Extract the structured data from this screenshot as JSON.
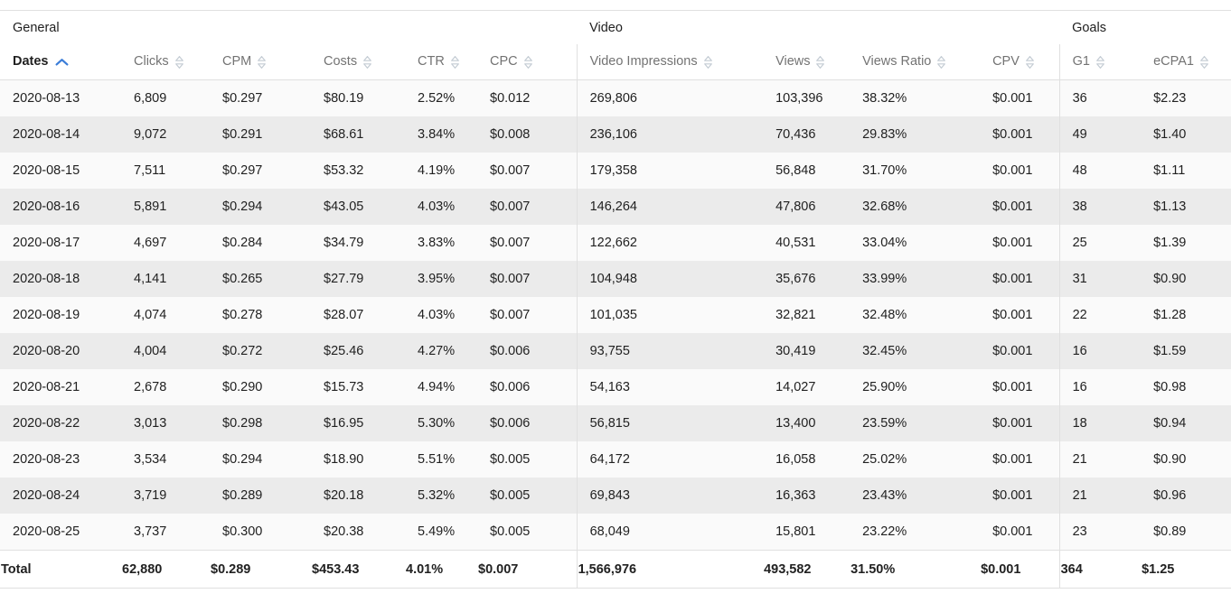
{
  "groups": [
    {
      "id": "general",
      "label": "General",
      "span": 6
    },
    {
      "id": "video",
      "label": "Video",
      "span": 4
    },
    {
      "id": "goals",
      "label": "Goals",
      "span": 2
    }
  ],
  "sort": {
    "active_column": "Dates",
    "direction": "asc",
    "active_color": "#3b7dd8",
    "inactive_color": "#c4ccd4"
  },
  "columns": [
    {
      "key": "dates",
      "label": "Dates",
      "sortable": true,
      "active": true
    },
    {
      "key": "clicks",
      "label": "Clicks",
      "sortable": true,
      "active": false
    },
    {
      "key": "cpm",
      "label": "CPM",
      "sortable": true,
      "active": false
    },
    {
      "key": "costs",
      "label": "Costs",
      "sortable": true,
      "active": false
    },
    {
      "key": "ctr",
      "label": "CTR",
      "sortable": true,
      "active": false
    },
    {
      "key": "cpc",
      "label": "CPC",
      "sortable": true,
      "active": false
    },
    {
      "key": "vimp",
      "label": "Video Impressions",
      "sortable": true,
      "active": false
    },
    {
      "key": "views",
      "label": "Views",
      "sortable": true,
      "active": false
    },
    {
      "key": "vratio",
      "label": "Views Ratio",
      "sortable": true,
      "active": false
    },
    {
      "key": "cpv",
      "label": "CPV",
      "sortable": true,
      "active": false
    },
    {
      "key": "g1",
      "label": "G1",
      "sortable": true,
      "active": false
    },
    {
      "key": "ecpa1",
      "label": "eCPA1",
      "sortable": true,
      "active": false
    }
  ],
  "rows": [
    {
      "dates": "2020-08-13",
      "clicks": "6,809",
      "cpm": "$0.297",
      "costs": "$80.19",
      "ctr": "2.52%",
      "cpc": "$0.012",
      "vimp": "269,806",
      "views": "103,396",
      "vratio": "38.32%",
      "cpv": "$0.001",
      "g1": "36",
      "ecpa1": "$2.23"
    },
    {
      "dates": "2020-08-14",
      "clicks": "9,072",
      "cpm": "$0.291",
      "costs": "$68.61",
      "ctr": "3.84%",
      "cpc": "$0.008",
      "vimp": "236,106",
      "views": "70,436",
      "vratio": "29.83%",
      "cpv": "$0.001",
      "g1": "49",
      "ecpa1": "$1.40"
    },
    {
      "dates": "2020-08-15",
      "clicks": "7,511",
      "cpm": "$0.297",
      "costs": "$53.32",
      "ctr": "4.19%",
      "cpc": "$0.007",
      "vimp": "179,358",
      "views": "56,848",
      "vratio": "31.70%",
      "cpv": "$0.001",
      "g1": "48",
      "ecpa1": "$1.11"
    },
    {
      "dates": "2020-08-16",
      "clicks": "5,891",
      "cpm": "$0.294",
      "costs": "$43.05",
      "ctr": "4.03%",
      "cpc": "$0.007",
      "vimp": "146,264",
      "views": "47,806",
      "vratio": "32.68%",
      "cpv": "$0.001",
      "g1": "38",
      "ecpa1": "$1.13"
    },
    {
      "dates": "2020-08-17",
      "clicks": "4,697",
      "cpm": "$0.284",
      "costs": "$34.79",
      "ctr": "3.83%",
      "cpc": "$0.007",
      "vimp": "122,662",
      "views": "40,531",
      "vratio": "33.04%",
      "cpv": "$0.001",
      "g1": "25",
      "ecpa1": "$1.39"
    },
    {
      "dates": "2020-08-18",
      "clicks": "4,141",
      "cpm": "$0.265",
      "costs": "$27.79",
      "ctr": "3.95%",
      "cpc": "$0.007",
      "vimp": "104,948",
      "views": "35,676",
      "vratio": "33.99%",
      "cpv": "$0.001",
      "g1": "31",
      "ecpa1": "$0.90"
    },
    {
      "dates": "2020-08-19",
      "clicks": "4,074",
      "cpm": "$0.278",
      "costs": "$28.07",
      "ctr": "4.03%",
      "cpc": "$0.007",
      "vimp": "101,035",
      "views": "32,821",
      "vratio": "32.48%",
      "cpv": "$0.001",
      "g1": "22",
      "ecpa1": "$1.28"
    },
    {
      "dates": "2020-08-20",
      "clicks": "4,004",
      "cpm": "$0.272",
      "costs": "$25.46",
      "ctr": "4.27%",
      "cpc": "$0.006",
      "vimp": "93,755",
      "views": "30,419",
      "vratio": "32.45%",
      "cpv": "$0.001",
      "g1": "16",
      "ecpa1": "$1.59"
    },
    {
      "dates": "2020-08-21",
      "clicks": "2,678",
      "cpm": "$0.290",
      "costs": "$15.73",
      "ctr": "4.94%",
      "cpc": "$0.006",
      "vimp": "54,163",
      "views": "14,027",
      "vratio": "25.90%",
      "cpv": "$0.001",
      "g1": "16",
      "ecpa1": "$0.98"
    },
    {
      "dates": "2020-08-22",
      "clicks": "3,013",
      "cpm": "$0.298",
      "costs": "$16.95",
      "ctr": "5.30%",
      "cpc": "$0.006",
      "vimp": "56,815",
      "views": "13,400",
      "vratio": "23.59%",
      "cpv": "$0.001",
      "g1": "18",
      "ecpa1": "$0.94"
    },
    {
      "dates": "2020-08-23",
      "clicks": "3,534",
      "cpm": "$0.294",
      "costs": "$18.90",
      "ctr": "5.51%",
      "cpc": "$0.005",
      "vimp": "64,172",
      "views": "16,058",
      "vratio": "25.02%",
      "cpv": "$0.001",
      "g1": "21",
      "ecpa1": "$0.90"
    },
    {
      "dates": "2020-08-24",
      "clicks": "3,719",
      "cpm": "$0.289",
      "costs": "$20.18",
      "ctr": "5.32%",
      "cpc": "$0.005",
      "vimp": "69,843",
      "views": "16,363",
      "vratio": "23.43%",
      "cpv": "$0.001",
      "g1": "21",
      "ecpa1": "$0.96"
    },
    {
      "dates": "2020-08-25",
      "clicks": "3,737",
      "cpm": "$0.300",
      "costs": "$20.38",
      "ctr": "5.49%",
      "cpc": "$0.005",
      "vimp": "68,049",
      "views": "15,801",
      "vratio": "23.22%",
      "cpv": "$0.001",
      "g1": "23",
      "ecpa1": "$0.89"
    }
  ],
  "total": {
    "dates": "Total",
    "clicks": "62,880",
    "cpm": "$0.289",
    "costs": "$453.43",
    "ctr": "4.01%",
    "cpc": "$0.007",
    "vimp": "1,566,976",
    "views": "493,582",
    "vratio": "31.50%",
    "cpv": "$0.001",
    "g1": "364",
    "ecpa1": "$1.25"
  }
}
